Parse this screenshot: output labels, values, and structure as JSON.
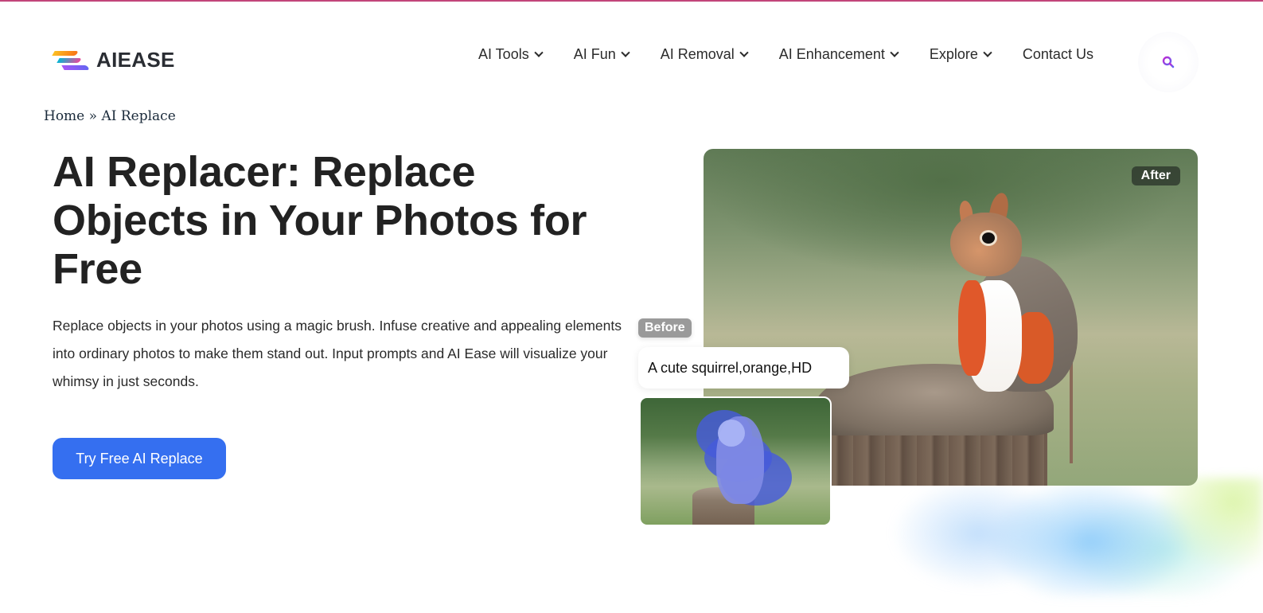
{
  "header": {
    "logo_text": "AIEASE",
    "nav": [
      {
        "label": "AI Tools",
        "has_dropdown": true
      },
      {
        "label": "AI Fun",
        "has_dropdown": true
      },
      {
        "label": "AI Removal",
        "has_dropdown": true
      },
      {
        "label": "AI Enhancement",
        "has_dropdown": true
      },
      {
        "label": "Explore",
        "has_dropdown": true
      },
      {
        "label": "Contact Us",
        "has_dropdown": false
      }
    ],
    "search_icon": "search-icon"
  },
  "breadcrumb": {
    "home": "Home",
    "separator": "»",
    "current": "AI Replace"
  },
  "hero": {
    "title": "AI Replacer: Replace Objects in Your Photos for Free",
    "description": "Replace objects in your photos using a magic brush. Infuse creative and appealing elements into ordinary photos to make them stand out. Input prompts and AI Ease will visualize your whimsy in just seconds.",
    "cta_label": "Try Free AI Replace"
  },
  "showcase": {
    "after_label": "After",
    "before_label": "Before",
    "prompt_text": "A cute squirrel,orange,HD"
  },
  "colors": {
    "accent_top_line": "#c2457a",
    "cta_background": "#356ff0",
    "title_text": "#222222"
  }
}
